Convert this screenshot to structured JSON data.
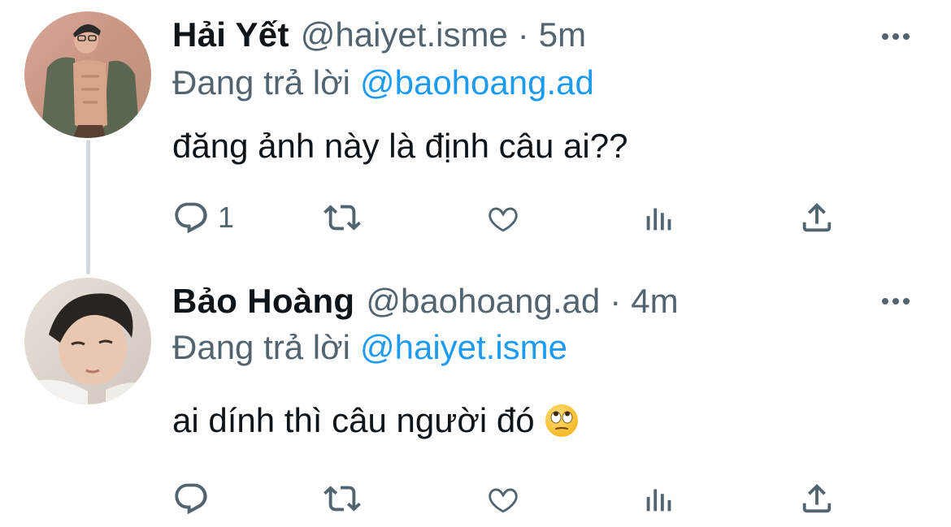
{
  "tweets": [
    {
      "author_name": "Hải Yết",
      "handle": "@haiyet.isme",
      "separator": "·",
      "time": "5m",
      "reply_prefix": "Đang trả lời",
      "reply_to": "@baohoang.ad",
      "text": "đăng ảnh này là định câu ai??",
      "reply_count": "1",
      "avatar_icon": "avatar-photo"
    },
    {
      "author_name": "Bảo Hoàng",
      "handle": "@baohoang.ad",
      "separator": "·",
      "time": "4m",
      "reply_prefix": "Đang trả lời",
      "reply_to": "@haiyet.isme",
      "text": "ai dính thì câu người đó",
      "text_emoji": "face-with-rolling-eyes",
      "reply_count": "",
      "avatar_icon": "avatar-photo"
    }
  ],
  "icons": {
    "reply": "reply-icon",
    "retweet": "retweet-icon",
    "like": "heart-icon",
    "views": "views-icon",
    "share": "share-icon",
    "more": "more-icon"
  },
  "colors": {
    "text_primary": "#0f1419",
    "text_secondary": "#536471",
    "link": "#1d9bf0",
    "thread_line": "#cfd9de"
  }
}
